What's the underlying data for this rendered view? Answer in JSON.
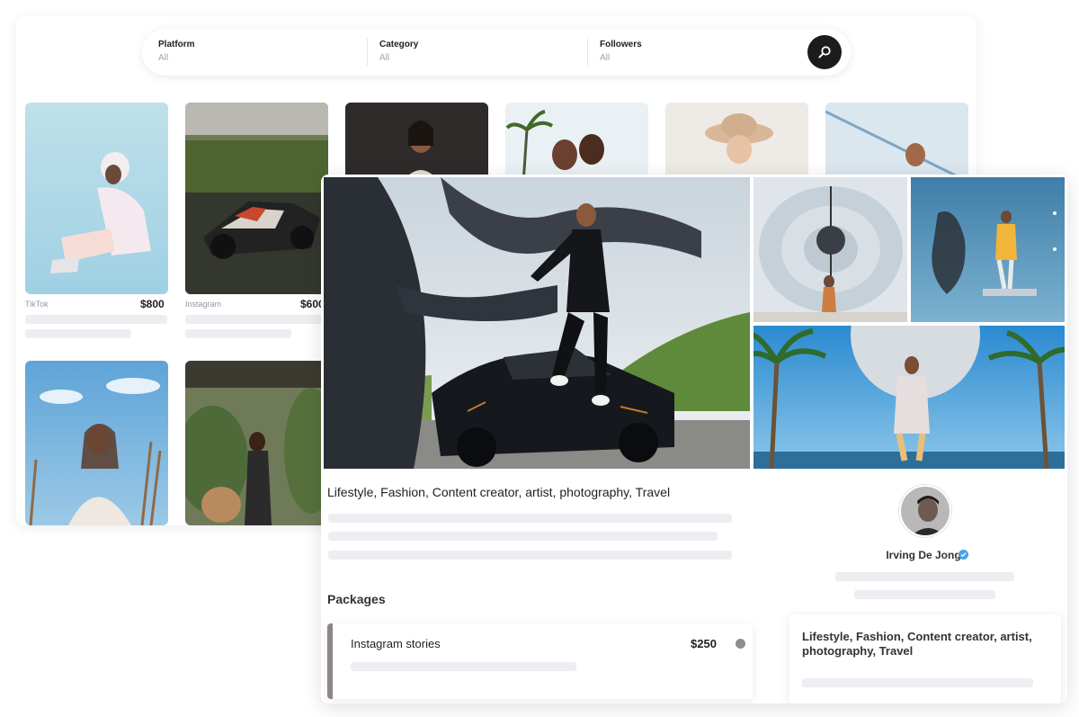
{
  "filters": [
    {
      "label": "Platform",
      "value": "All"
    },
    {
      "label": "Category",
      "value": "All"
    },
    {
      "label": "Followers",
      "value": "All"
    }
  ],
  "search": {
    "icon": "search-icon"
  },
  "listings": [
    {
      "platform": "TikTok",
      "price": "$800"
    },
    {
      "platform": "Instagram",
      "price": "$600"
    }
  ],
  "profile": {
    "categories": "Lifestyle, Fashion, Content creator, artist, photography, Travel",
    "packages_title": "Packages",
    "package": {
      "name": "Instagram stories",
      "price": "$250"
    },
    "creator": {
      "name": "Irving De Jong",
      "verified": true
    }
  },
  "colors": {
    "search_button": "#1c1c1c",
    "verified_badge": "#4aa3e8",
    "package_accent": "#8d858b"
  }
}
